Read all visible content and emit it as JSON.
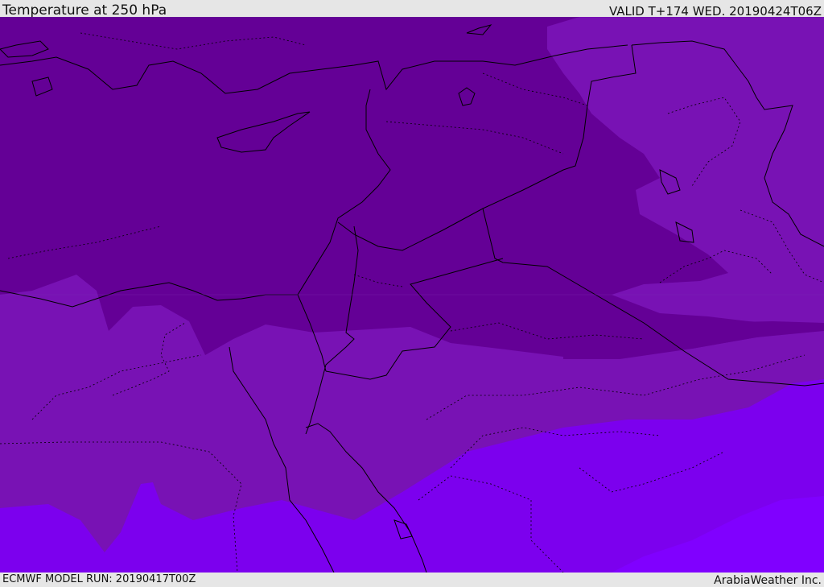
{
  "header": {
    "title": "Temperature at 250 hPa",
    "valid": "VALID T+174 WED. 20190424T06Z"
  },
  "footer": {
    "model_run": "ECMWF MODEL RUN: 20190417T00Z",
    "credit": "ArabiaWeather Inc."
  },
  "colors": {
    "band_coldest": "#640096",
    "band_mid": "#7812b4",
    "band_warm": "#7c00ee",
    "band_warmest": "#8000ff",
    "border": "#000000"
  }
}
